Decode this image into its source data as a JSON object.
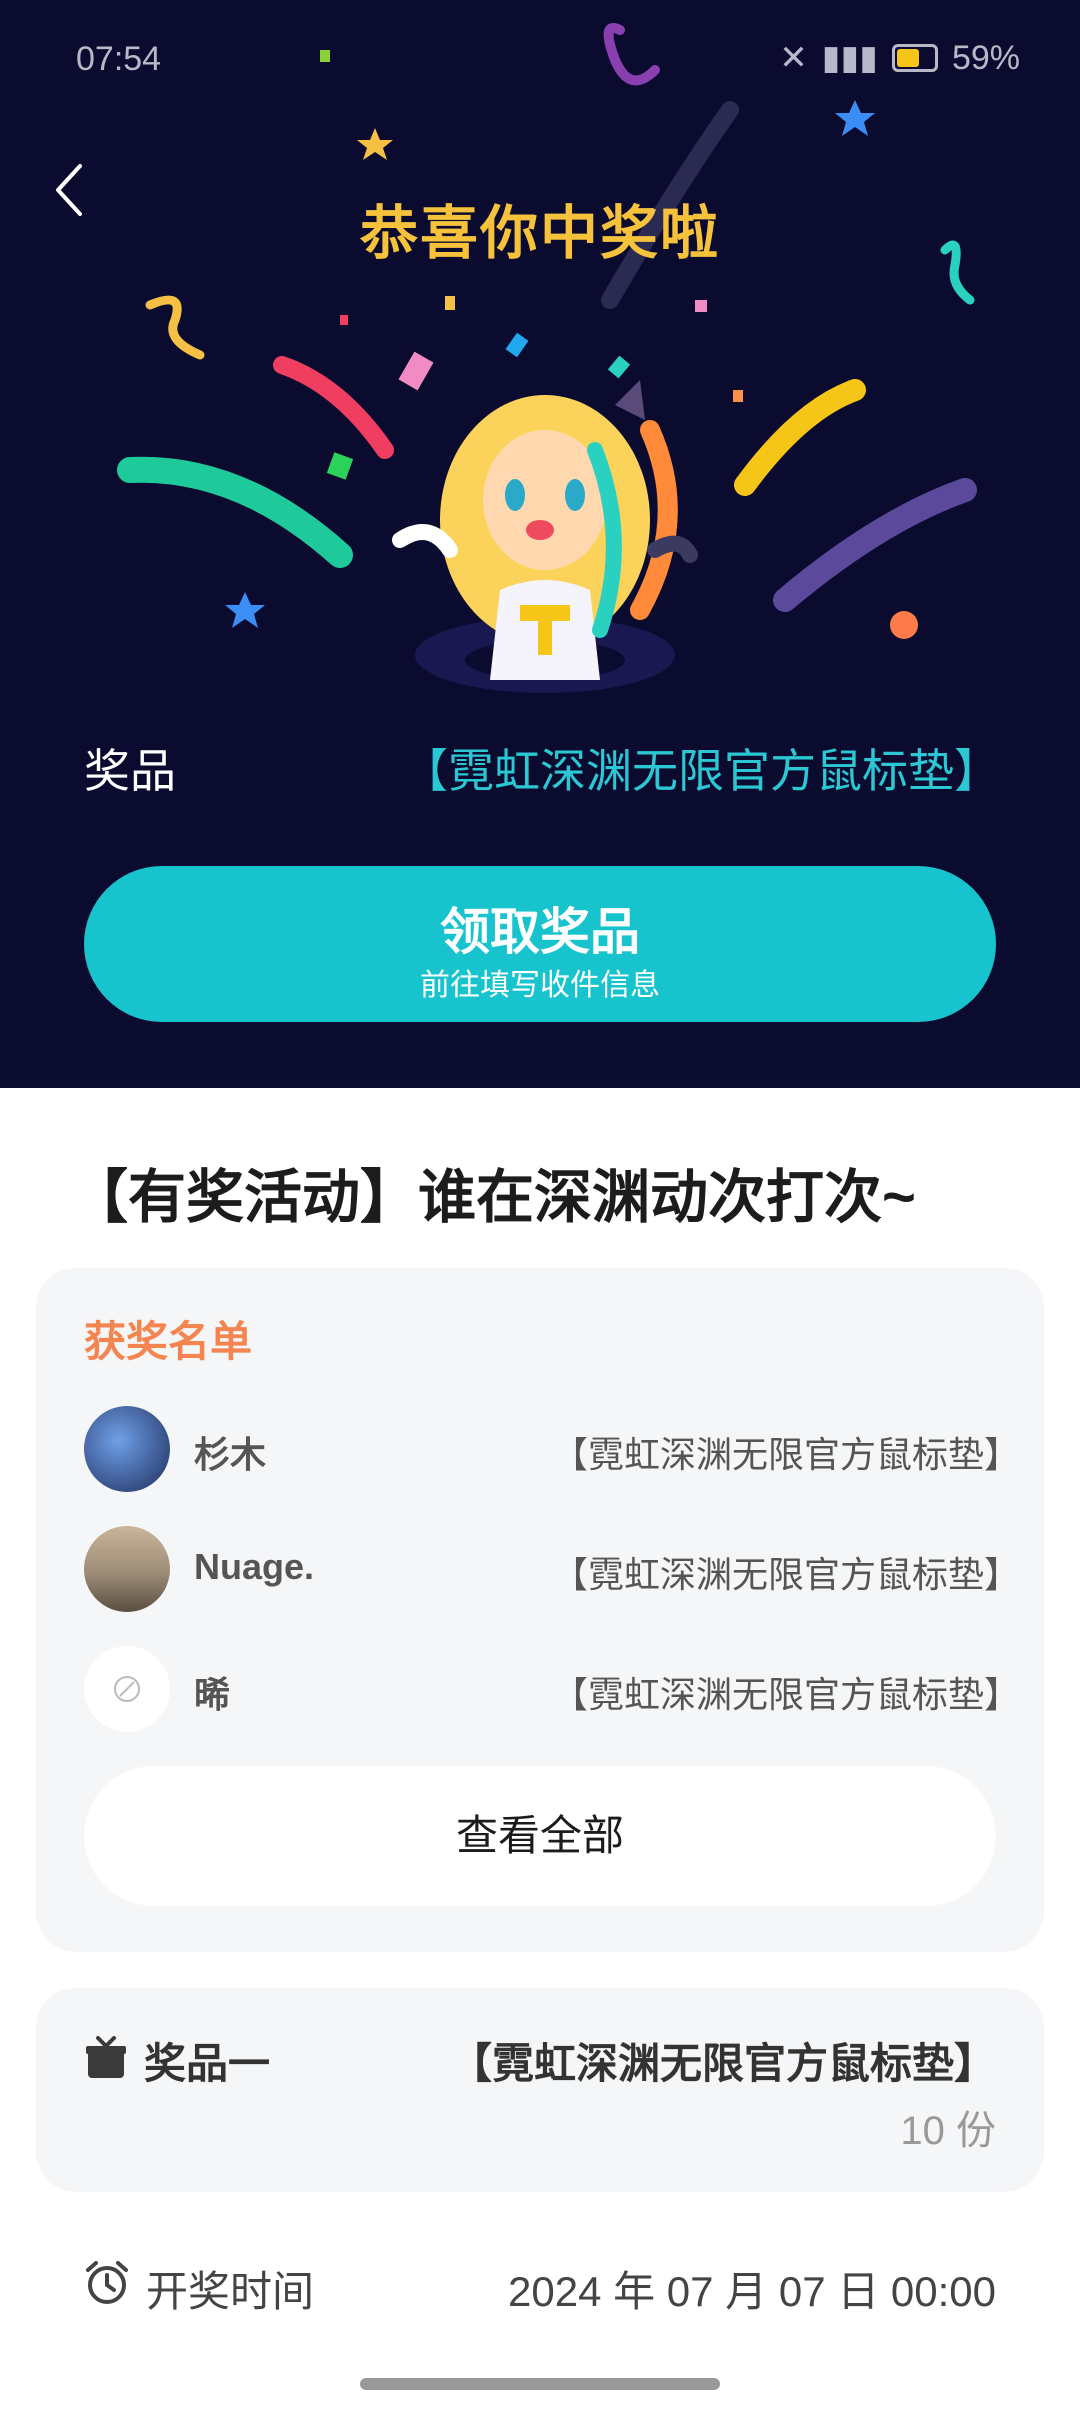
{
  "status": {
    "time": "07:54",
    "battery": "59%"
  },
  "hero": {
    "title": "恭喜你中奖啦",
    "prize_label": "奖品",
    "prize_value": "【霓虹深渊无限官方鼠标垫】",
    "claim_button": "领取奖品",
    "claim_sub": "前往填写收件信息"
  },
  "activity_title": "【有奖活动】谁在深渊动次打次~",
  "winners": {
    "heading": "获奖名单",
    "list": [
      {
        "name": "杉木",
        "prize": "【霓虹深渊无限官方鼠标垫】"
      },
      {
        "name": "Nuage.",
        "prize": "【霓虹深渊无限官方鼠标垫】"
      },
      {
        "name": "晞",
        "prize": "【霓虹深渊无限官方鼠标垫】"
      }
    ],
    "view_all": "查看全部"
  },
  "prize_item": {
    "label": "奖品一",
    "value": "【霓虹深渊无限官方鼠标垫】",
    "count": "10 份"
  },
  "draw_time": {
    "label": "开奖时间",
    "value": "2024 年 07 月 07 日 00:00"
  },
  "colors": {
    "hero_bg": "#0b0a2f",
    "accent_teal": "#17c4cd",
    "title_gold": "#f7c23b",
    "winners_orange": "#f58550"
  }
}
